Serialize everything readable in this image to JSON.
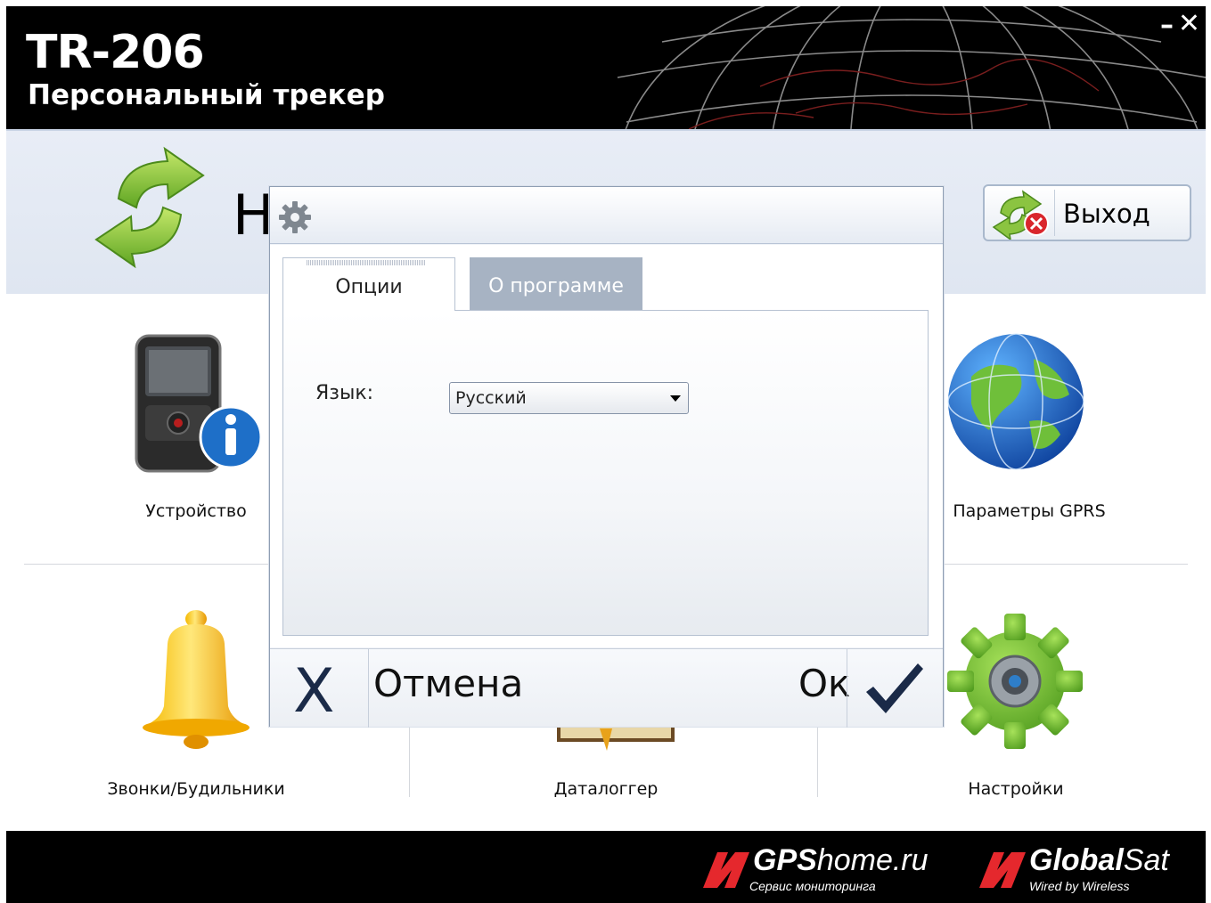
{
  "header": {
    "title": "TR-206",
    "subtitle": "Персональный трекер",
    "minimize": "–",
    "close": "✕"
  },
  "main": {
    "heading_partial": "Н",
    "exit_label": "Выход",
    "tiles": [
      {
        "label": "Устройство",
        "icon": "phone-info-icon"
      },
      {
        "label": "Параметры GPRS",
        "icon": "globe-icon"
      },
      {
        "label": "Звонки/Будильники",
        "icon": "bell-icon"
      },
      {
        "label": "Даталоггер",
        "icon": "map-icon"
      },
      {
        "label": "Настройки",
        "icon": "green-gear-icon"
      }
    ]
  },
  "dialog": {
    "tabs": [
      {
        "label": "Опции",
        "active": true
      },
      {
        "label": "О программе",
        "active": false
      }
    ],
    "language_label": "Язык:",
    "language_value": "Русский",
    "cancel_label": "Отмена",
    "cancel_icon": "X",
    "ok_label": "Ок"
  },
  "footer": {
    "logo1_name_bold": "GPS",
    "logo1_name_rest": "home.ru",
    "logo1_tagline": "Сервис мониторинга",
    "logo2_name_bold": "Global",
    "logo2_name_rest": "Sat",
    "logo2_tagline": "Wired by Wireless"
  },
  "colors": {
    "accent_red": "#e5282d",
    "dialog_tab_inactive": "#a7b3c3",
    "icon_navy": "#1a2a48"
  }
}
